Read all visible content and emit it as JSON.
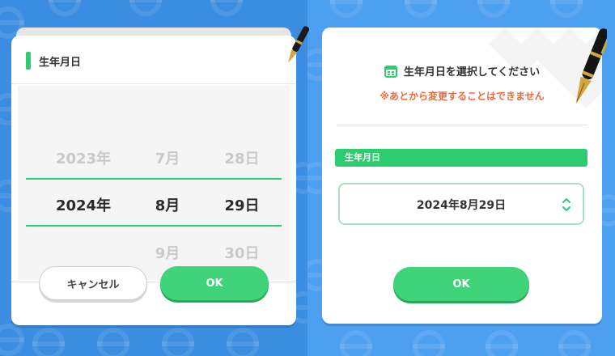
{
  "left_panel": {
    "header_title": "生年月日",
    "picker": {
      "years": [
        "2023年",
        "2024年",
        ""
      ],
      "months": [
        "7月",
        "8月",
        "9月"
      ],
      "days": [
        "28日",
        "29日",
        "30日"
      ],
      "selected_index": 1
    },
    "cancel_label": "キャンセル",
    "ok_label": "OK"
  },
  "right_panel": {
    "title": "生年月日を選択してください",
    "warning": "※あとから変更することはできません",
    "field_label": "生年月日",
    "date_value": "2024年8月29日",
    "ok_label": "OK"
  },
  "colors": {
    "background_left": "#3a8de0",
    "background_right": "#4d9ff0",
    "accent_green": "#2ecc71",
    "warning_orange": "#ef6a3a"
  },
  "icons": [
    "calendar-icon",
    "fountain-pen-icon",
    "chevron-up-down-icon"
  ]
}
